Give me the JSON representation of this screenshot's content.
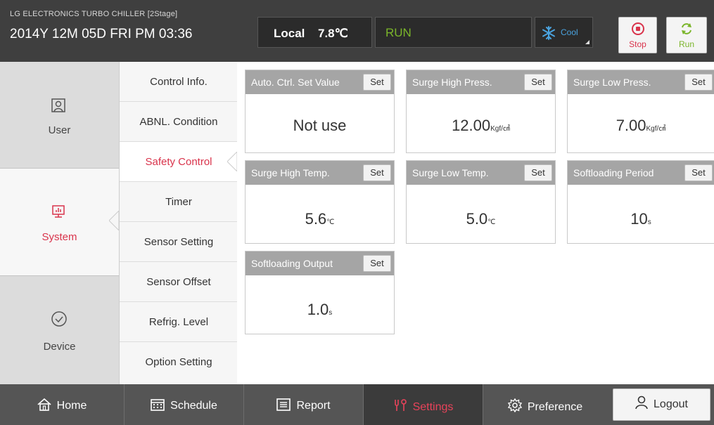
{
  "header": {
    "app_title": "LG ELECTRONICS TURBO CHILLER [2Stage]",
    "datetime": "2014Y 12M 05D  FRI PM 03:36",
    "mode": "Local",
    "temperature": "7.8℃",
    "status": "RUN",
    "operation": "Cool",
    "stop_label": "Stop",
    "run_label": "Run"
  },
  "left_nav": {
    "items": [
      {
        "label": "User",
        "icon": "user-icon"
      },
      {
        "label": "System",
        "icon": "monitor-icon"
      },
      {
        "label": "Device",
        "icon": "check-circle-icon"
      }
    ],
    "active": "System"
  },
  "sub_menu": {
    "items": [
      "Control Info.",
      "ABNL. Condition",
      "Safety Control",
      "Timer",
      "Sensor Setting",
      "Sensor Offset",
      "Refrig. Level",
      "Option Setting"
    ],
    "active": "Safety Control"
  },
  "cards": [
    {
      "title": "Auto. Ctrl. Set Value",
      "value": "Not use",
      "unit": "",
      "set": "Set"
    },
    {
      "title": "Surge High Press.",
      "value": "12.00",
      "unit": "Kgf/㎠",
      "set": "Set"
    },
    {
      "title": "Surge Low Press.",
      "value": "7.00",
      "unit": "Kgf/㎠",
      "set": "Set"
    },
    {
      "title": "Surge High Temp.",
      "value": "5.6",
      "unit": "℃",
      "set": "Set"
    },
    {
      "title": "Surge Low Temp.",
      "value": "5.0",
      "unit": "℃",
      "set": "Set"
    },
    {
      "title": "Softloading Period",
      "value": "10",
      "unit": "s",
      "set": "Set"
    },
    {
      "title": "Softloading Output",
      "value": "1.0",
      "unit": "s",
      "set": "Set"
    }
  ],
  "bottom_tabs": [
    {
      "label": "Home",
      "icon": "home-icon"
    },
    {
      "label": "Schedule",
      "icon": "calendar-icon"
    },
    {
      "label": "Report",
      "icon": "report-icon"
    },
    {
      "label": "Settings",
      "icon": "settings-icon"
    },
    {
      "label": "Preference",
      "icon": "gear-icon"
    }
  ],
  "active_tab": "Settings",
  "logout_label": "Logout",
  "colors": {
    "accent": "#d9334b",
    "run_green": "#7ab52a",
    "cool_blue": "#4aa3df"
  }
}
